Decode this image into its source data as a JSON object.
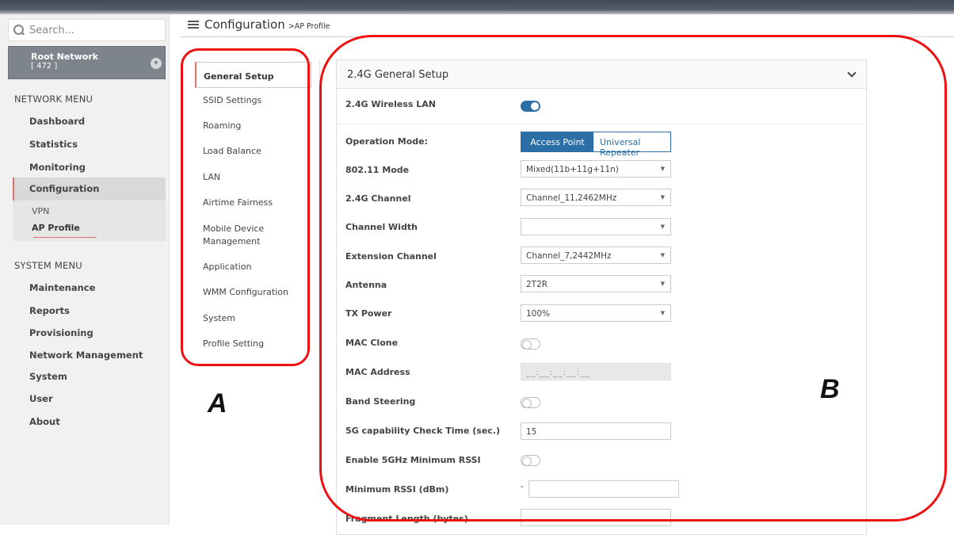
{
  "sidebar": {
    "search_placeholder": "Search...",
    "root_network": {
      "name": "Root Network",
      "count": "[ 472 ]"
    },
    "network_menu_title": "NETWORK MENU",
    "network_items": [
      "Dashboard",
      "Statistics",
      "Monitoring",
      "Configuration"
    ],
    "config_sub_items": [
      "VPN",
      "AP Profile"
    ],
    "system_menu_title": "SYSTEM MENU",
    "system_items": [
      "Maintenance",
      "Reports",
      "Provisioning",
      "Network Management",
      "System",
      "User",
      "About"
    ]
  },
  "breadcrumb": {
    "title": "Configuration",
    "sub": ">AP Profile"
  },
  "tabs": [
    "General Setup",
    "SSID Settings",
    "Roaming",
    "Load Balance",
    "LAN",
    "Airtime Fairness",
    "Mobile Device Management",
    "Application",
    "WMM Configuration",
    "System",
    "Profile Setting"
  ],
  "panel": {
    "title": "2.4G General Setup",
    "fields": {
      "wireless_lan": {
        "label": "2.4G Wireless LAN",
        "state": "on"
      },
      "operation_mode": {
        "label": "Operation Mode:",
        "options": [
          "Access Point",
          "Universal Repeater"
        ],
        "selected": "Access Point"
      },
      "mode_80211": {
        "label": "802.11 Mode",
        "value": "Mixed(11b+11g+11n)"
      },
      "channel": {
        "label": "2.4G Channel",
        "value": "Channel_11,2462MHz"
      },
      "channel_width": {
        "label": "Channel Width",
        "value": ""
      },
      "extension_channel": {
        "label": "Extension Channel",
        "value": "Channel_7,2442MHz"
      },
      "antenna": {
        "label": "Antenna",
        "value": "2T2R"
      },
      "tx_power": {
        "label": "TX Power",
        "value": "100%"
      },
      "mac_clone": {
        "label": "MAC Clone",
        "state": "off"
      },
      "mac_address": {
        "label": "MAC Address",
        "value": "__:__:__:__:__"
      },
      "band_steering": {
        "label": "Band Steering",
        "state": "off"
      },
      "check_time": {
        "label": "5G capability Check Time (sec.)",
        "value": "15"
      },
      "min_rssi_enable": {
        "label": "Enable 5GHz Minimum RSSI",
        "state": "off"
      },
      "min_rssi": {
        "label": "Minimum RSSI (dBm)",
        "prefix": "-",
        "value": ""
      },
      "fragment_length": {
        "label": "Fragment Length (bytes)",
        "value": ""
      }
    }
  },
  "annotations": [
    "A",
    "B"
  ],
  "colors": {
    "accent": "#2c6fa6",
    "annotation": "#ee1111",
    "active_marker": "#e07070"
  }
}
